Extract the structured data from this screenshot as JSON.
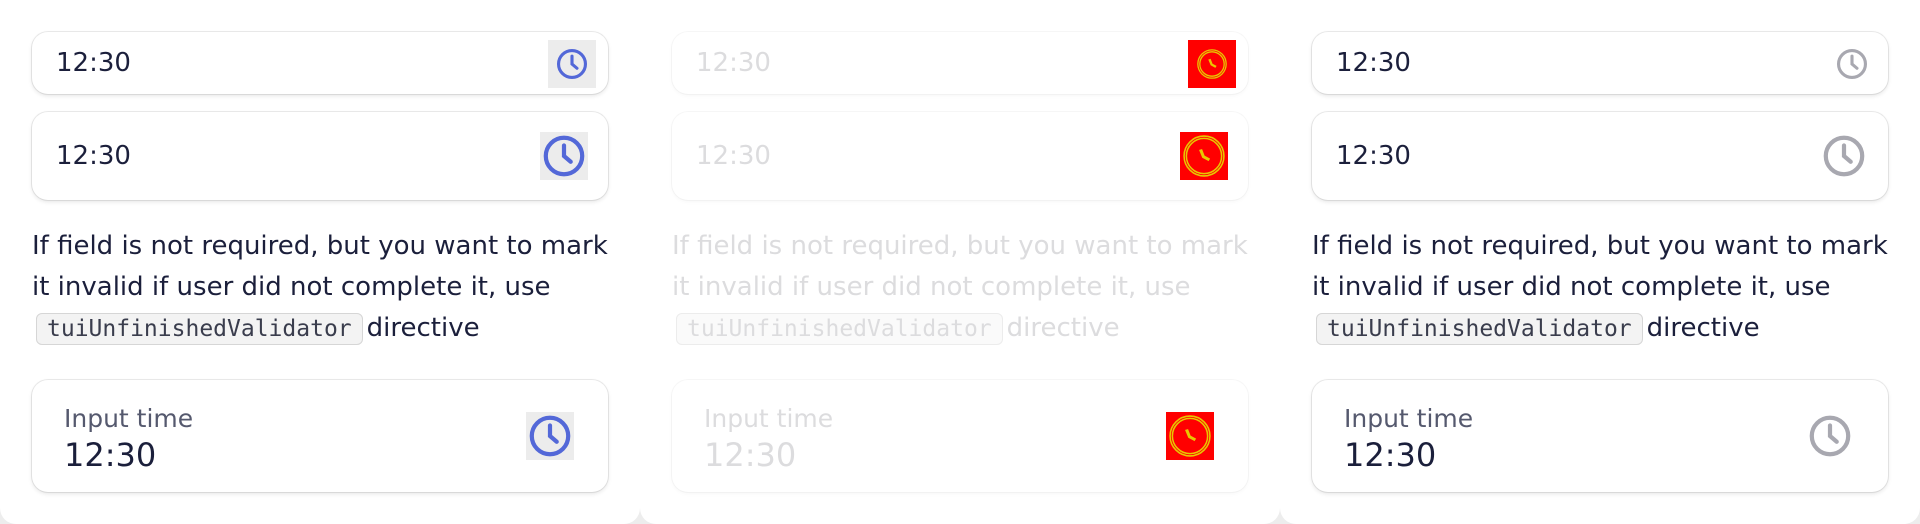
{
  "panels": [
    {
      "state": "default",
      "small_value": "12:30",
      "medium_value": "12:30",
      "hint_text_1": "If field is not required, but you want to mark it invalid if user did not complete it, use",
      "hint_code": "tuiUnfinishedValidator",
      "hint_text_2": "directive",
      "large_label": "Input time",
      "large_value": "12:30"
    },
    {
      "state": "disabled",
      "small_value": "12:30",
      "medium_value": "12:30",
      "hint_text_1": "If field is not required, but you want to mark it invalid if user did not complete it, use",
      "hint_code": "tuiUnfinishedValidator",
      "hint_text_2": "directive",
      "large_label": "Input time",
      "large_value": "12:30"
    },
    {
      "state": "readonly",
      "small_value": "12:30",
      "medium_value": "12:30",
      "hint_text_1": "If field is not required, but you want to mark it invalid if user did not complete it, use",
      "hint_code": "tuiUnfinishedValidator",
      "hint_text_2": "directive",
      "large_label": "Input time",
      "large_value": "12:30"
    }
  ],
  "icons": {
    "clock": "clock-icon"
  },
  "colors": {
    "icon_active": "#5368d8",
    "icon_muted": "#a8a8b0",
    "icon_disabled_bg": "#ff0000",
    "icon_disabled_stroke": "#e8c800",
    "text": "#1b1f3b",
    "label": "#55596e"
  }
}
